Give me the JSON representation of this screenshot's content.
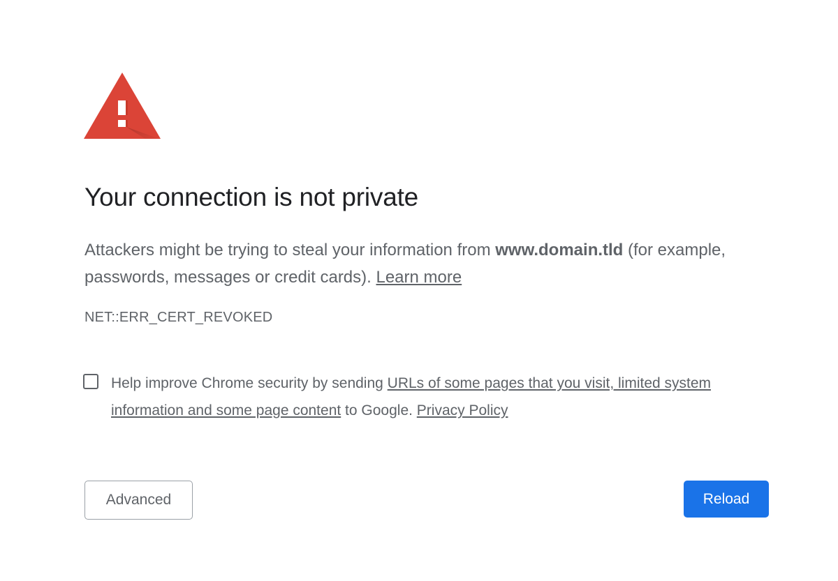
{
  "interstitial": {
    "icon": "warning-triangle-icon",
    "accent_color": "#db4437",
    "title": "Your connection is not private",
    "explanation": {
      "before_domain": "Attackers might be trying to steal your information from ",
      "domain": "www.domain.tld",
      "after_domain": " (for example, passwords, messages or credit cards). ",
      "learn_more": "Learn more"
    },
    "error_code": "NET::ERR_CERT_REVOKED",
    "optin": {
      "checked": false,
      "prefix": "Help improve Chrome security by sending ",
      "link_text": "URLs of some pages that you visit, limited system information and some page content",
      "middle": " to Google. ",
      "privacy_policy": "Privacy Policy"
    },
    "buttons": {
      "advanced": "Advanced",
      "reload": "Reload",
      "reload_color": "#1a73e8"
    }
  }
}
